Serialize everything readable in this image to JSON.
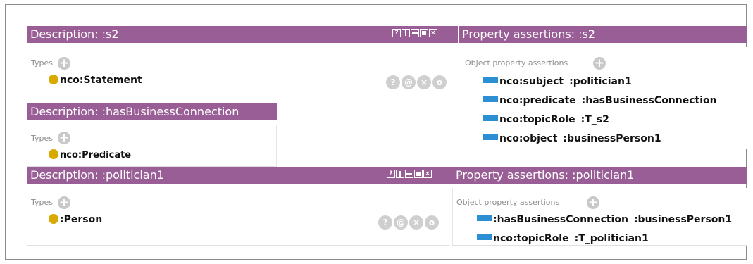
{
  "panels": {
    "desc_s2": {
      "title": "Description: :s2",
      "types_label": "Types",
      "type_item": "nco:Statement"
    },
    "prop_s2": {
      "title": "Property assertions: :s2",
      "section_label": "Object property assertions",
      "assertions": [
        {
          "property": "nco:subject",
          "value": ":politician1"
        },
        {
          "property": "nco:predicate",
          "value": ":hasBusinessConnection"
        },
        {
          "property": "nco:topicRole",
          "value": ":T_s2"
        },
        {
          "property": "nco:object",
          "value": ":businessPerson1"
        }
      ]
    },
    "desc_hbc": {
      "title": "Description: :hasBusinessConnection",
      "types_label": "Types",
      "type_item": "nco:Predicate"
    },
    "desc_pol": {
      "title": "Description: :politician1",
      "types_label": "Types",
      "type_item": ":Person"
    },
    "prop_pol": {
      "title": "Property assertions: :politician1",
      "section_label": "Object property assertions",
      "assertions": [
        {
          "property": ":hasBusinessConnection",
          "value": ":businessPerson1"
        },
        {
          "property": "nco:topicRole",
          "value": ":T_politician1"
        }
      ]
    }
  },
  "icons": {
    "plus": "+",
    "help": "?",
    "annotate": "@",
    "delete": "×",
    "describe": "o",
    "window_help": "?"
  },
  "colors": {
    "header_bg": "#9a5e96",
    "class_dot": "#d8aa00",
    "property_bar": "#2d8fd3"
  }
}
